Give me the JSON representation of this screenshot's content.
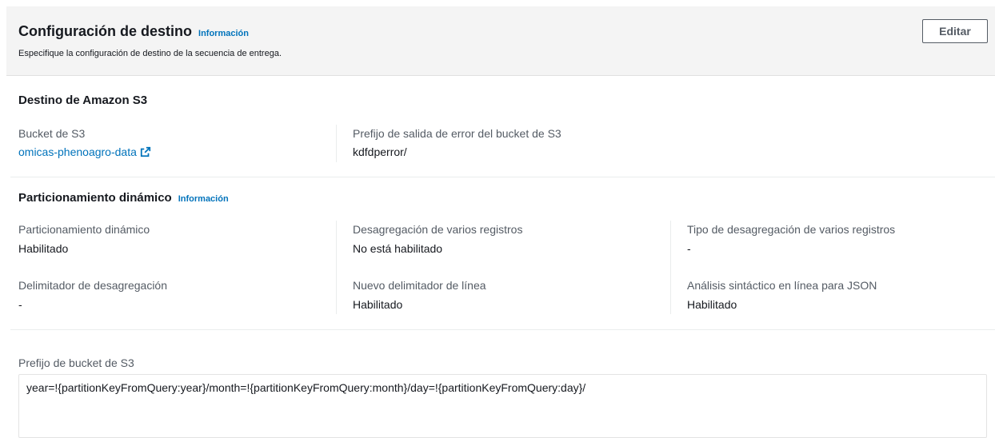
{
  "header": {
    "title": "Configuración de destino",
    "info_label": "Información",
    "description": "Especifique la configuración de destino de la secuencia de entrega.",
    "edit_label": "Editar"
  },
  "s3_destination": {
    "title": "Destino de Amazon S3",
    "bucket_label": "Bucket de S3",
    "bucket_value": "omicas-phenoagro-data",
    "bucket_icon": "external-link-icon",
    "error_prefix_label": "Prefijo de salida de error del bucket de S3",
    "error_prefix_value": "kdfdperror/"
  },
  "dynamic_partitioning": {
    "title": "Particionamiento dinámico",
    "info_label": "Información",
    "fields": [
      {
        "label": "Particionamiento dinámico",
        "value": "Habilitado"
      },
      {
        "label": "Desagregación de varios registros",
        "value": "No está habilitado"
      },
      {
        "label": "Tipo de desagregación de varios registros",
        "value": "-"
      },
      {
        "label": "Delimitador de desagregación",
        "value": "-"
      },
      {
        "label": "Nuevo delimitador de línea",
        "value": "Habilitado"
      },
      {
        "label": "Análisis sintáctico en línea para JSON",
        "value": "Habilitado"
      }
    ]
  },
  "bucket_prefix": {
    "label": "Prefijo de bucket de S3",
    "value": "year=!{partitionKeyFromQuery:year}/month=!{partitionKeyFromQuery:month}/day=!{partitionKeyFromQuery:day}/"
  },
  "colors": {
    "link": "#0073bb",
    "header_bg": "#f4f4f4"
  }
}
